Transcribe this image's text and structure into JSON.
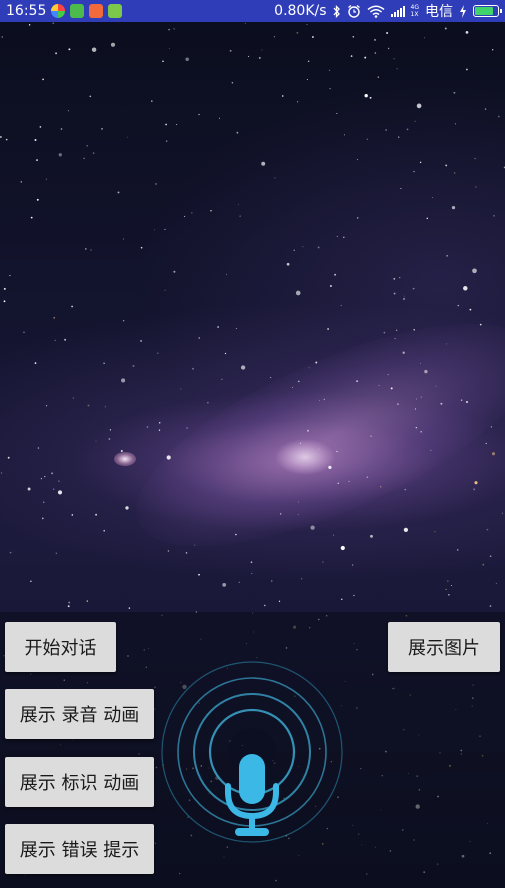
{
  "status_bar": {
    "time": "16:55",
    "speed": "0.80K/s",
    "net_top": "4G",
    "net_bottom": "1X",
    "carrier": "电信",
    "battery_level": 0.85,
    "notification_icons": [
      "app-icon-colorful",
      "app-icon-green",
      "app-icon-orange",
      "android-icon"
    ],
    "system_icons": [
      "bluetooth-icon",
      "alarm-icon",
      "wifi-icon",
      "signal-icon",
      "charging-icon",
      "battery-icon"
    ]
  },
  "buttons": {
    "start_dialog": "开始对话",
    "show_image": "展示图片",
    "show_record_anim": "展示 录音 动画",
    "show_marker_anim": "展示 标识 动画",
    "show_error_tip": "展示 错误 提示"
  },
  "mic": {
    "icon": "microphone-icon",
    "color": "#3cb8e6",
    "ring_color": "#3a9fc4"
  },
  "colors": {
    "status_bar": "#2f3db8",
    "button_bg": "#dcdcdc",
    "battery_fill": "#40d46a"
  }
}
